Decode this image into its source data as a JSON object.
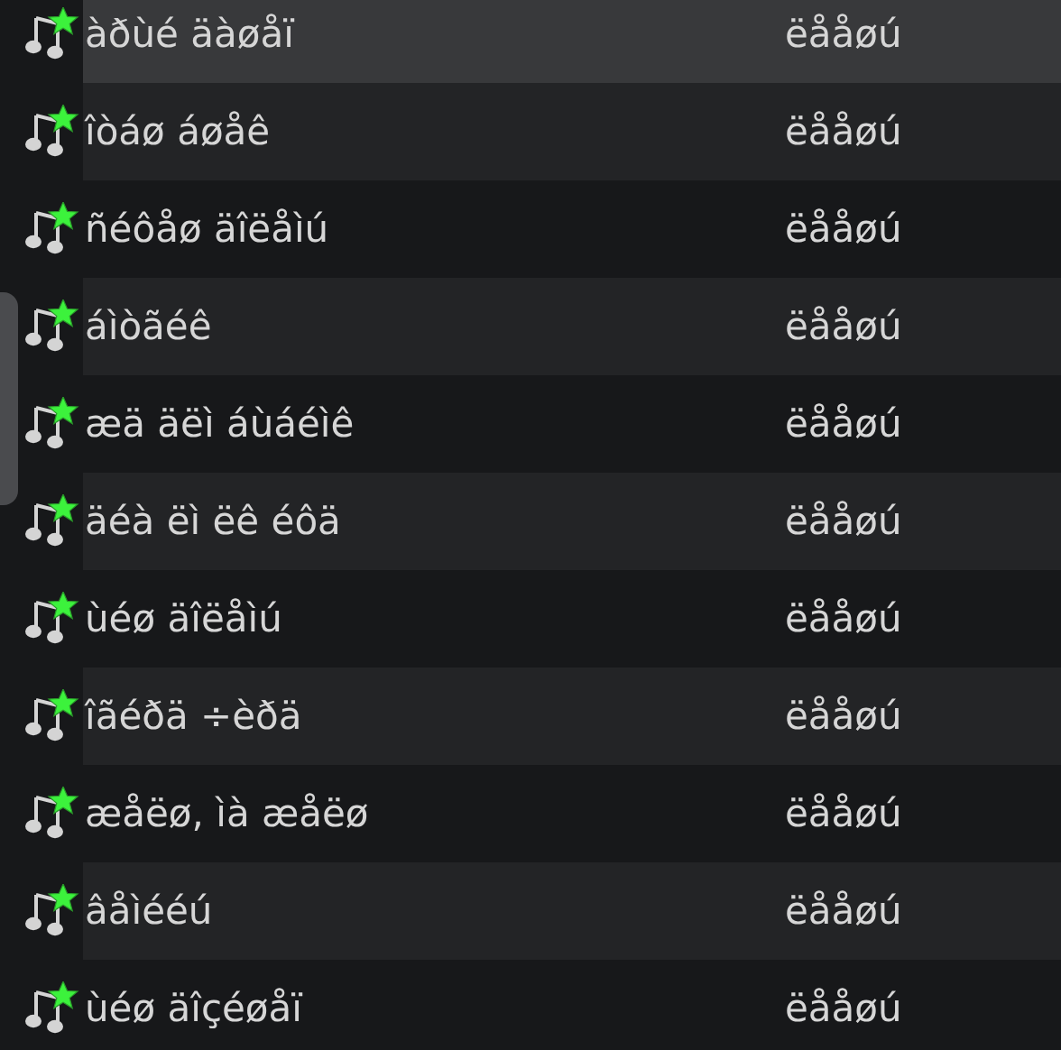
{
  "tracks": [
    {
      "title": "àðùé äàøåï",
      "column_2": "ëååøú",
      "selected": true
    },
    {
      "title": "îòáø áøåê",
      "column_2": "ëååøú",
      "selected": false
    },
    {
      "title": "ñéôåø äîëåìú",
      "column_2": "ëååøú",
      "selected": false
    },
    {
      "title": "áìòãéê",
      "column_2": "ëååøú",
      "selected": false
    },
    {
      "title": "æä äëì áùáéìê",
      "column_2": "ëååøú",
      "selected": false
    },
    {
      "title": "äéà ëì ëê éôä",
      "column_2": "ëååøú",
      "selected": false
    },
    {
      "title": "ùéø äîëåìú",
      "column_2": "ëååøú",
      "selected": false
    },
    {
      "title": "îãéðä ÷èðä",
      "column_2": "ëååøú",
      "selected": false
    },
    {
      "title": "æåëø, ìà æåëø",
      "column_2": "ëååøú",
      "selected": false
    },
    {
      "title": "âåìééú",
      "column_2": "ëååøú",
      "selected": false
    },
    {
      "title": "ùéø äîçéøåï",
      "column_2": "ëååøú",
      "selected": false
    }
  ]
}
